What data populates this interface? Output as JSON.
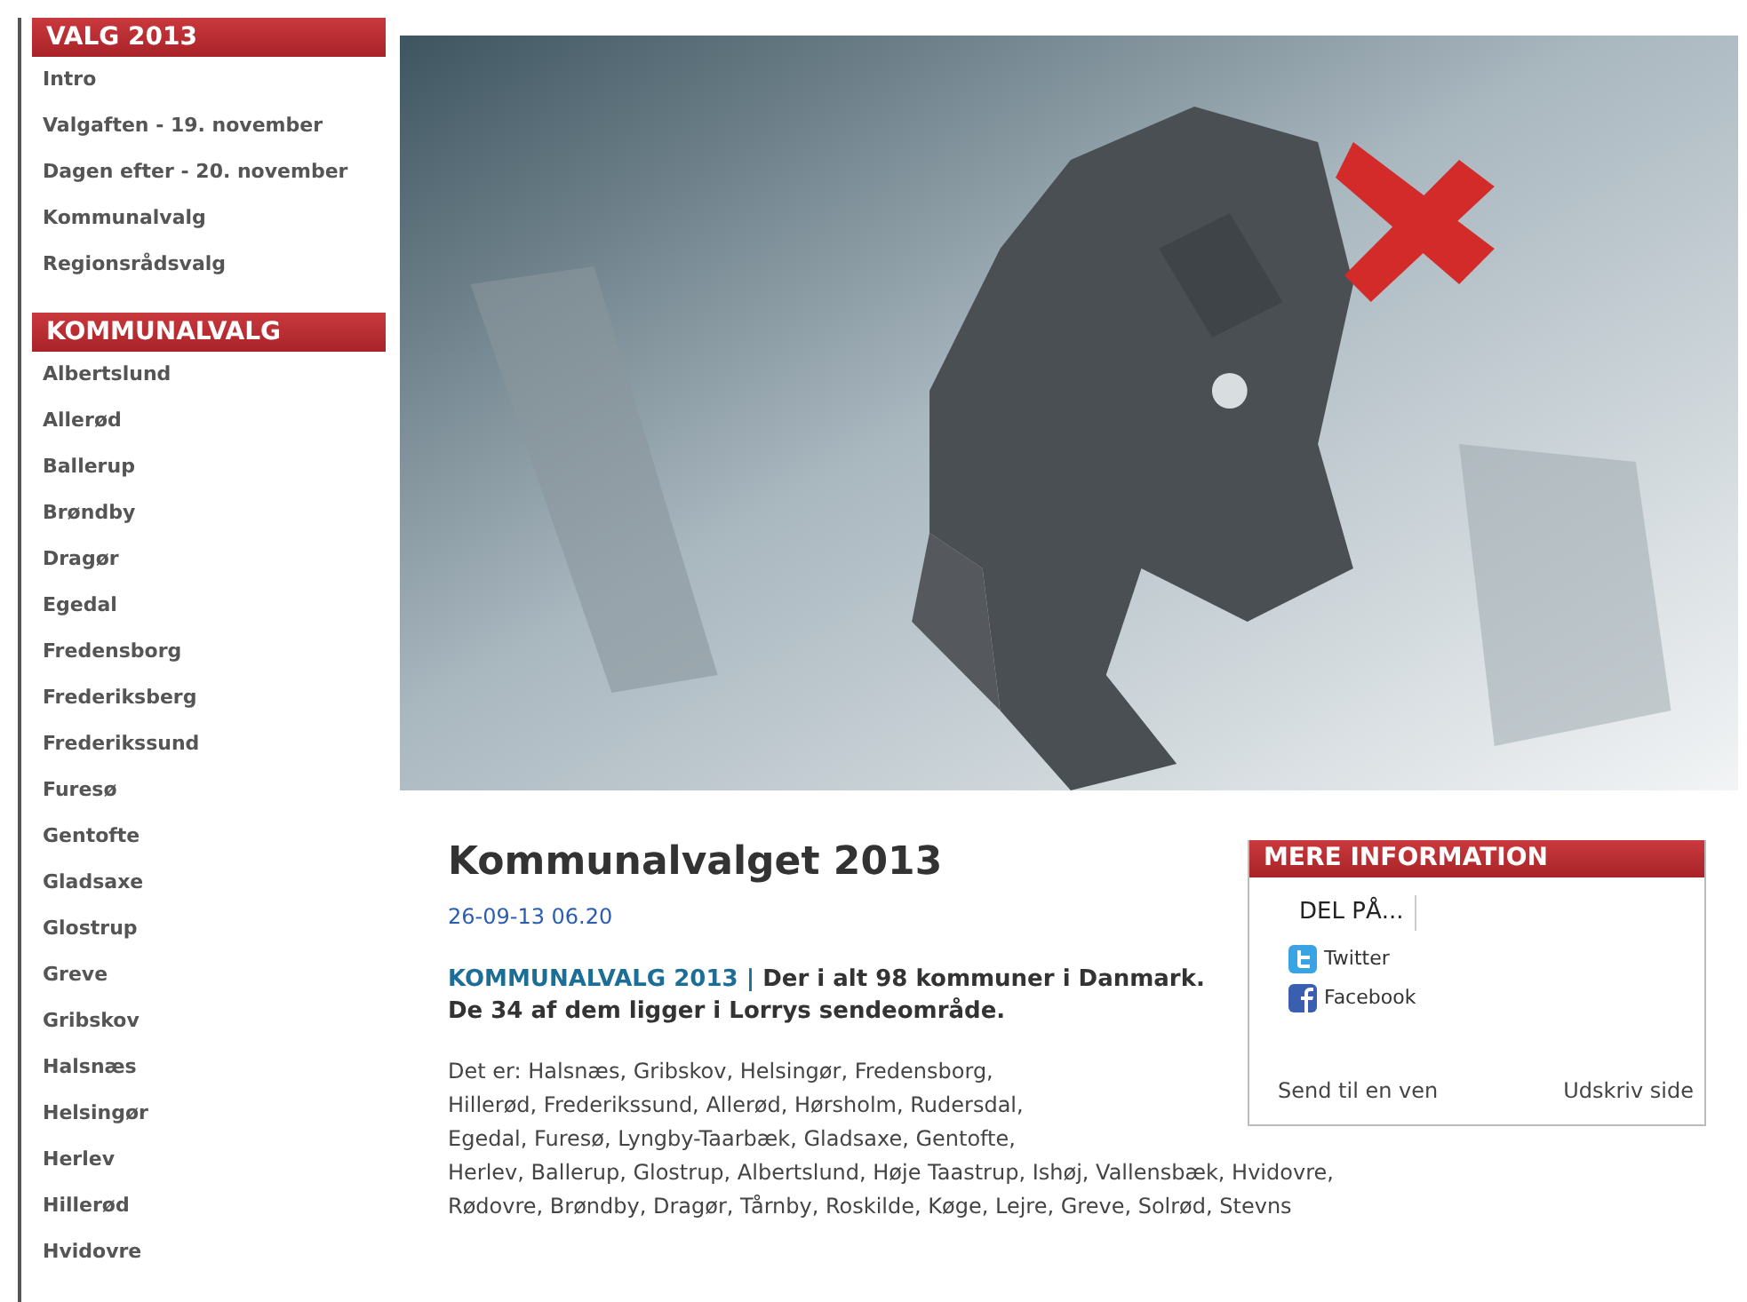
{
  "sidebar": [
    {
      "heading": "VALG 2013",
      "items": [
        "Intro",
        "Valgaften - 19. november",
        "Dagen efter - 20. november",
        "Kommunalvalg",
        "Regionsrådsvalg"
      ]
    },
    {
      "heading": "KOMMUNALVALG",
      "items": [
        "Albertslund",
        "Allerød",
        "Ballerup",
        "Brøndby",
        "Dragør",
        "Egedal",
        "Fredensborg",
        "Frederiksberg",
        "Frederikssund",
        "Furesø",
        "Gentofte",
        "Gladsaxe",
        "Glostrup",
        "Greve",
        "Gribskov",
        "Halsnæs",
        "Helsingør",
        "Herlev",
        "Hillerød",
        "Hvidovre"
      ]
    }
  ],
  "article": {
    "title": "Kommunalvalget 2013",
    "date": "26-09-13 06.20",
    "kicker": "KOMMUNALVALG 2013 |",
    "lead": "Der i alt 98 kommuner i Danmark. De 34 af dem ligger i Lorrys sendeområde.",
    "body_lines": [
      "Det er: Halsnæs, Gribskov, Helsingør, Fredensborg,",
      "Hillerød, Frederikssund, Allerød, Hørsholm, Rudersdal,",
      "Egedal, Furesø, Lyngby-Taarbæk, Gladsaxe, Gentofte,",
      "Herlev, Ballerup, Glostrup, Albertslund, Høje Taastrup, Ishøj, Vallensbæk, Hvidovre,",
      "Rødovre, Brøndby, Dragør, Tårnby, Roskilde, Køge, Lejre, Greve, Solrød, Stevns"
    ]
  },
  "info_box": {
    "heading": "MERE INFORMATION",
    "share_label": "DEL PÅ...",
    "share_links": [
      {
        "kind": "twitter",
        "label": "Twitter"
      },
      {
        "kind": "facebook",
        "label": "Facebook"
      }
    ],
    "footer_links": [
      "Send til en ven",
      "Udskriv side"
    ]
  }
}
